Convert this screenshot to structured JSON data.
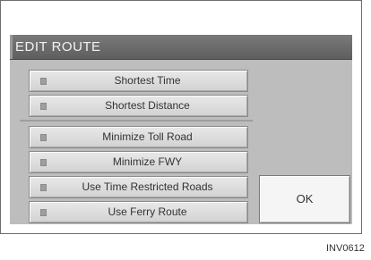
{
  "title": "EDIT ROUTE",
  "options": [
    {
      "label": "Shortest Time"
    },
    {
      "label": "Shortest Distance"
    },
    {
      "label": "Minimize Toll Road"
    },
    {
      "label": "Minimize FWY"
    },
    {
      "label": "Use Time Restricted Roads"
    },
    {
      "label": "Use Ferry Route"
    }
  ],
  "ok_label": "OK",
  "figure_code": "INV0612"
}
